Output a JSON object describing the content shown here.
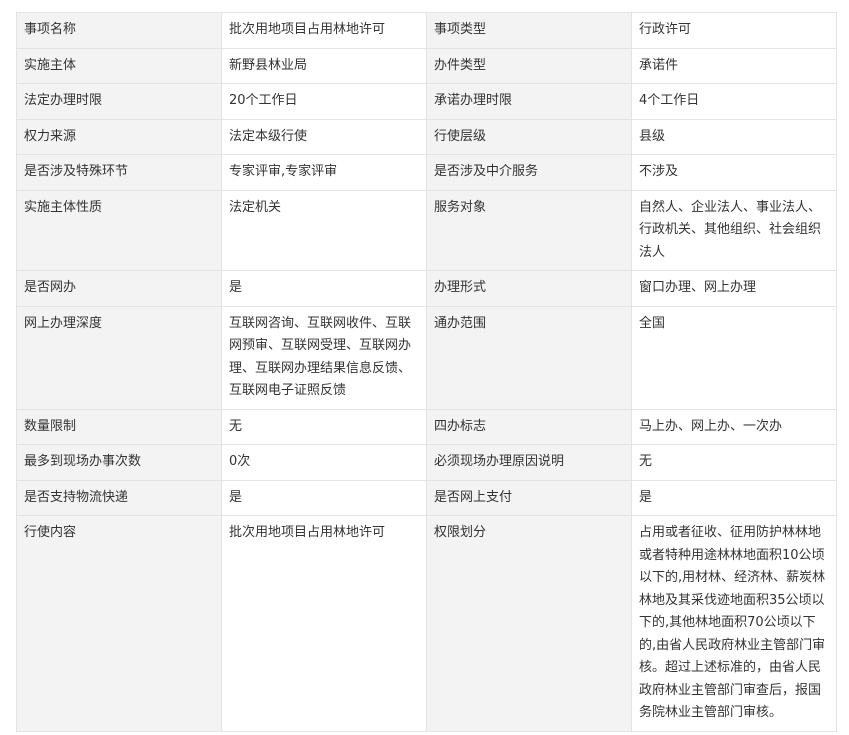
{
  "table": {
    "rows": [
      {
        "label1": "事项名称",
        "value1": "批次用地项目占用林地许可",
        "label2": "事项类型",
        "value2": "行政许可"
      },
      {
        "label1": "实施主体",
        "value1": "新野县林业局",
        "label2": "办件类型",
        "value2": "承诺件"
      },
      {
        "label1": "法定办理时限",
        "value1": "20个工作日",
        "label2": "承诺办理时限",
        "value2": "4个工作日"
      },
      {
        "label1": "权力来源",
        "value1": "法定本级行使",
        "label2": "行使层级",
        "value2": "县级"
      },
      {
        "label1": "是否涉及特殊环节",
        "value1": "专家评审,专家评审",
        "label2": "是否涉及中介服务",
        "value2": "不涉及"
      },
      {
        "label1": "实施主体性质",
        "value1": "法定机关",
        "label2": "服务对象",
        "value2": "自然人、企业法人、事业法人、行政机关、其他组织、社会组织法人"
      },
      {
        "label1": "是否网办",
        "value1": "是",
        "label2": "办理形式",
        "value2": "窗口办理、网上办理"
      },
      {
        "label1": "网上办理深度",
        "value1": "互联网咨询、互联网收件、互联网预审、互联网受理、互联网办理、互联网办理结果信息反馈、互联网电子证照反馈",
        "label2": "通办范围",
        "value2": "全国"
      },
      {
        "label1": "数量限制",
        "value1": "无",
        "label2": "四办标志",
        "value2": "马上办、网上办、一次办"
      },
      {
        "label1": "最多到现场办事次数",
        "value1": "0次",
        "label2": "必须现场办理原因说明",
        "value2": "无"
      },
      {
        "label1": "是否支持物流快递",
        "value1": "是",
        "label2": "是否网上支付",
        "value2": "是"
      },
      {
        "label1": "行使内容",
        "value1": "批次用地项目占用林地许可",
        "label2": "权限划分",
        "value2": "占用或者征收、征用防护林林地或者特种用途林林地面积10公顷以下的,用材林、经济林、薪炭林林地及其采伐迹地面积35公顷以下的,其他林地面积70公顷以下的,由省人民政府林业主管部门审核。超过上述标准的，由省人民政府林业主管部门审查后，报国务院林业主管部门审核。"
      }
    ]
  }
}
